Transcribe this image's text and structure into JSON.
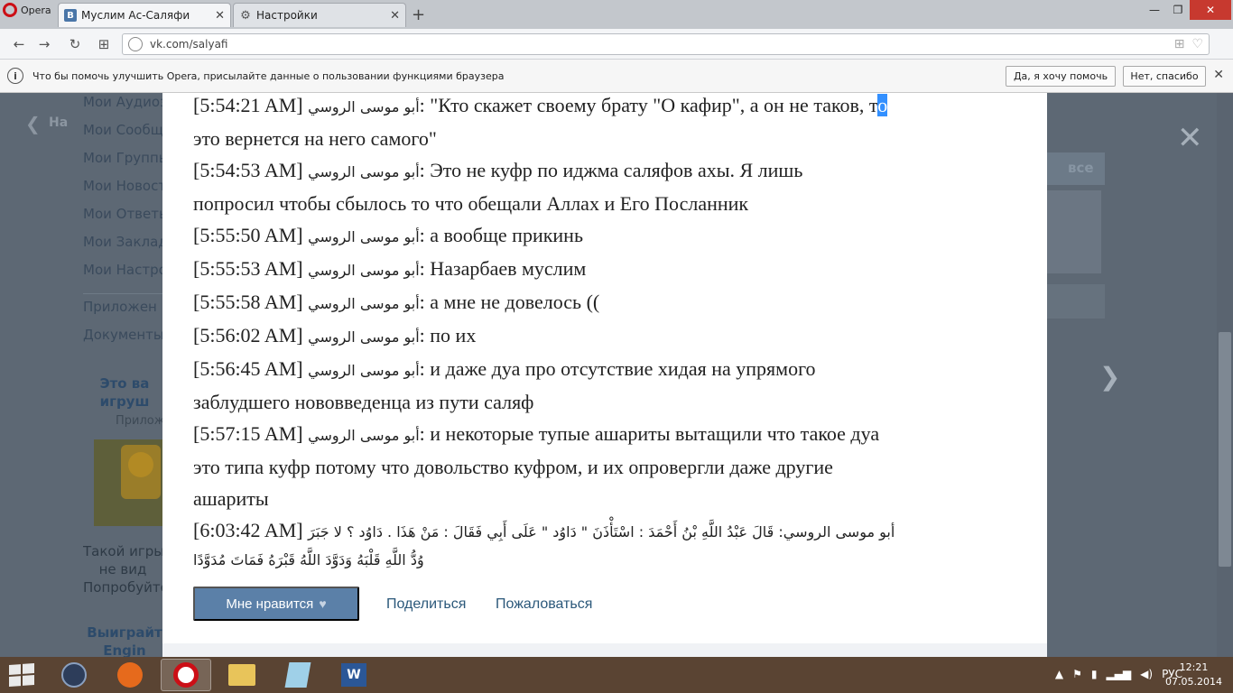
{
  "browser": {
    "menu_label": "Opera",
    "tabs": [
      {
        "title": "Муслим Ас-Саляфи",
        "favicon": "В"
      },
      {
        "title": "Настройки",
        "favicon": "⚙"
      }
    ],
    "new_tab": "+",
    "url": "vk.com/salyafi",
    "window_buttons": {
      "minimize": "—",
      "restore": "❐",
      "close": "✕"
    }
  },
  "infobar": {
    "message": "Что бы помочь улучшить Opera, присылайте данные о пользовании функциями браузера",
    "accept_label": "Да, я хочу помочь",
    "decline_label": "Нет, спасибо",
    "close": "✕"
  },
  "sidebar": {
    "back_label": "На",
    "items": [
      "Мои Аудиоз",
      "Мои Сообщ",
      "Мои Группы",
      "Мои Новост",
      "Мои Ответы",
      "Мои Заклад",
      "Мои Настро"
    ],
    "items2": [
      "Приложен",
      "Документы"
    ],
    "ad": {
      "title_lines": [
        "Это ва",
        "игруш"
      ],
      "sub": "Прилож",
      "text_lines": [
        "Такой игры",
        "не вид",
        "Попробуйте"
      ]
    },
    "ad2_lines": [
      "Выиграйт",
      "Engin"
    ]
  },
  "right": {
    "close": "✕",
    "all_label": "все",
    "next": "❯"
  },
  "post": {
    "lines": [
      {
        "time": "[5:54:21 AM]",
        "author": "أبو موسى الروسي",
        "text": ": \"Кто скажет своему брату \"О кафир\", а он не таков, т",
        "sel": "о"
      },
      {
        "text": "это вернется на него самого\""
      },
      {
        "time": "[5:54:53 AM]",
        "author": "أبو موسى الروسي",
        "text": ": Это не куфр по иджма саляфов ахы. Я лишь"
      },
      {
        "text": "попросил чтобы сбылось то что обещали Аллах и Его Посланник"
      },
      {
        "time": "[5:55:50 AM]",
        "author": "أبو موسى الروسي",
        "text": ": а вообще прикинь"
      },
      {
        "time": "[5:55:53 AM]",
        "author": "أبو موسى الروسي",
        "text": ": Назарбаев муслим"
      },
      {
        "time": "[5:55:58 AM]",
        "author": "أبو موسى الروسي",
        "text": ": а мне не довелось (("
      },
      {
        "time": "[5:56:02 AM]",
        "author": "أبو موسى الروسي",
        "text": ": по их"
      },
      {
        "time": "[5:56:45 AM]",
        "author": "أبو موسى الروسي",
        "text": ": и даже дуа про отсутствие хидая на упрямого"
      },
      {
        "text": "заблудшего нововведенца из пути саляф"
      },
      {
        "time": "[5:57:15 AM]",
        "author": "أبو موسى الروسي",
        "text": ": и некоторые тупые ашариты вытащили что такое дуа"
      },
      {
        "text": "это типа куфр потому что довольство куфром, и их опровергли даже другие"
      },
      {
        "text": "ашариты"
      }
    ],
    "arabic_time": "[6:03:42 AM]",
    "arabic_line1": "أبو موسى الروسي: قَالَ عَبْدُ اللَّهِ بْنُ أَحْمَدَ : اسْتَأْذَنَ \" دَاوُد \" عَلَى أَبِي فَقَالَ : مَنْ هَذَا . دَاوُد ؟ لا جَبَرَ",
    "arabic_line2": "وُدُّ اللَّهِ قَلْبَهُ وَدَوَّدَ اللَّهُ قَبْرَهُ فَمَاتَ مُدَوَّدًا",
    "like_label": "Мне нравится",
    "share_label": "Поделиться",
    "report_label": "Пожаловаться"
  },
  "taskbar": {
    "language": "РУС",
    "time": "12:21",
    "date": "07.05.2014"
  }
}
